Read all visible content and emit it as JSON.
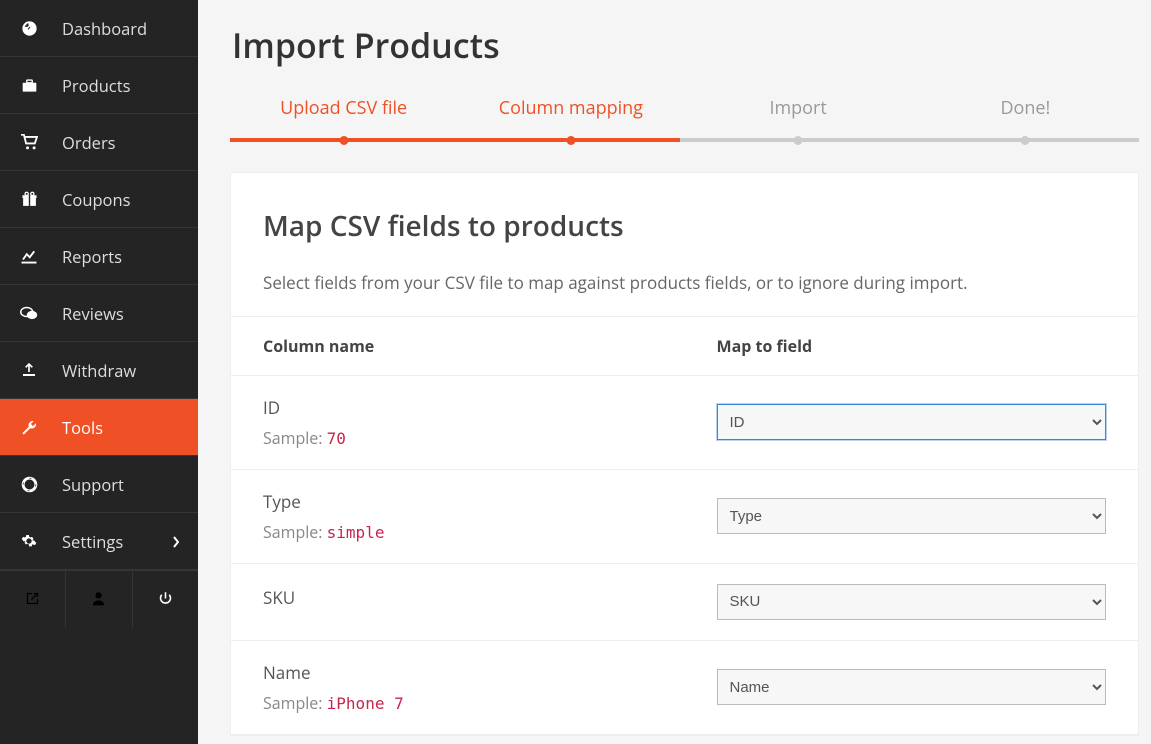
{
  "sidebar": {
    "items": [
      {
        "label": "Dashboard",
        "icon": "dashboard"
      },
      {
        "label": "Products",
        "icon": "briefcase"
      },
      {
        "label": "Orders",
        "icon": "cart"
      },
      {
        "label": "Coupons",
        "icon": "gift"
      },
      {
        "label": "Reports",
        "icon": "chart"
      },
      {
        "label": "Reviews",
        "icon": "comments"
      },
      {
        "label": "Withdraw",
        "icon": "upload"
      },
      {
        "label": "Tools",
        "icon": "wrench",
        "active": true
      },
      {
        "label": "Support",
        "icon": "lifebuoy"
      },
      {
        "label": "Settings",
        "icon": "gear",
        "chevron": true
      }
    ]
  },
  "page": {
    "title": "Import Products"
  },
  "steps": [
    {
      "label": "Upload CSV file",
      "active": true
    },
    {
      "label": "Column mapping",
      "active": true
    },
    {
      "label": "Import",
      "active": false
    },
    {
      "label": "Done!",
      "active": false
    }
  ],
  "card": {
    "heading": "Map CSV fields to products",
    "subtext": "Select fields from your CSV file to map against products fields, or to ignore during import."
  },
  "table": {
    "headers": {
      "col1": "Column name",
      "col2": "Map to field"
    },
    "sample_label": "Sample:",
    "rows": [
      {
        "name": "ID",
        "sample": "70",
        "map": "ID",
        "focused": true
      },
      {
        "name": "Type",
        "sample": "simple",
        "map": "Type"
      },
      {
        "name": "SKU",
        "sample": "",
        "map": "SKU"
      },
      {
        "name": "Name",
        "sample": "iPhone 7",
        "map": "Name"
      }
    ]
  }
}
